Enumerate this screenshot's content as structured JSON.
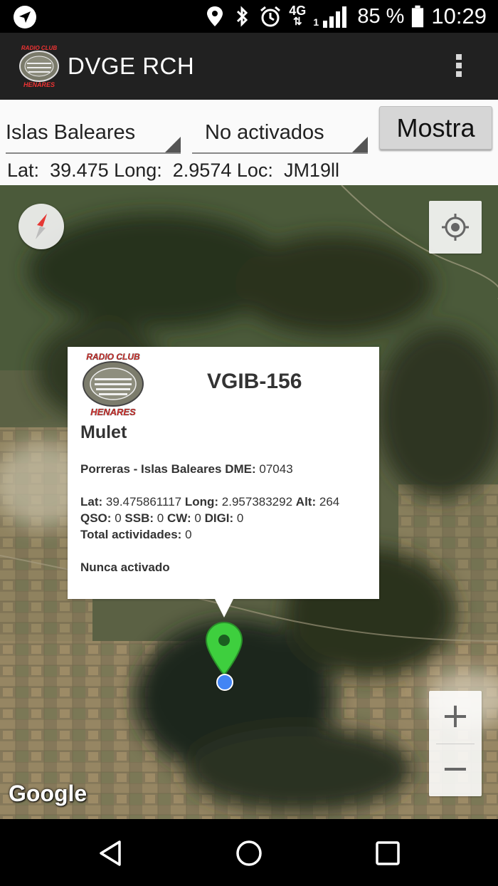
{
  "status_bar": {
    "network": "4G",
    "sim": "1",
    "battery": "85 %",
    "time": "10:29",
    "icons": [
      "navigation-icon",
      "location-pin-icon",
      "bluetooth-icon",
      "alarm-icon",
      "signal-icon",
      "battery-icon"
    ]
  },
  "app_bar": {
    "title": "DVGE RCH",
    "logo_text_top": "RADIO CLUB",
    "logo_text_bottom": "HENARES"
  },
  "controls": {
    "region_select": "Islas Baleares",
    "status_select": "No activados",
    "show_button": "Mostra",
    "lat_label": "Lat:",
    "lat_value": "39.475",
    "long_label": "Long:",
    "long_value": "2.9574",
    "loc_label": "Loc:",
    "loc_value": "JM19ll"
  },
  "info_window": {
    "logo_text_top": "RADIO CLUB",
    "logo_text_bottom": "HENARES",
    "code": "VGIB-156",
    "name": "Mulet",
    "place": "Porreras - Islas Baleares",
    "dme_label": "DME:",
    "dme_value": "07043",
    "lat_label": "Lat:",
    "lat_value": "39.475861117",
    "long_label": "Long:",
    "long_value": "2.957383292",
    "alt_label": "Alt:",
    "alt_value": "264",
    "qso_label": "QSO:",
    "qso_value": "0",
    "ssb_label": "SSB:",
    "ssb_value": "0",
    "cw_label": "CW:",
    "cw_value": "0",
    "digi_label": "DIGI:",
    "digi_value": "0",
    "total_label": "Total actividades:",
    "total_value": "0",
    "status_text": "Nunca activado"
  },
  "map": {
    "attribution": "Google",
    "zoom_in": "+",
    "zoom_out": "−",
    "marker_color": "#3ecf3e",
    "my_location_color": "#4285f4"
  },
  "colors": {
    "app_bar": "#212121",
    "controls_bg": "#fafafa",
    "button_bg": "#d6d6d6"
  }
}
